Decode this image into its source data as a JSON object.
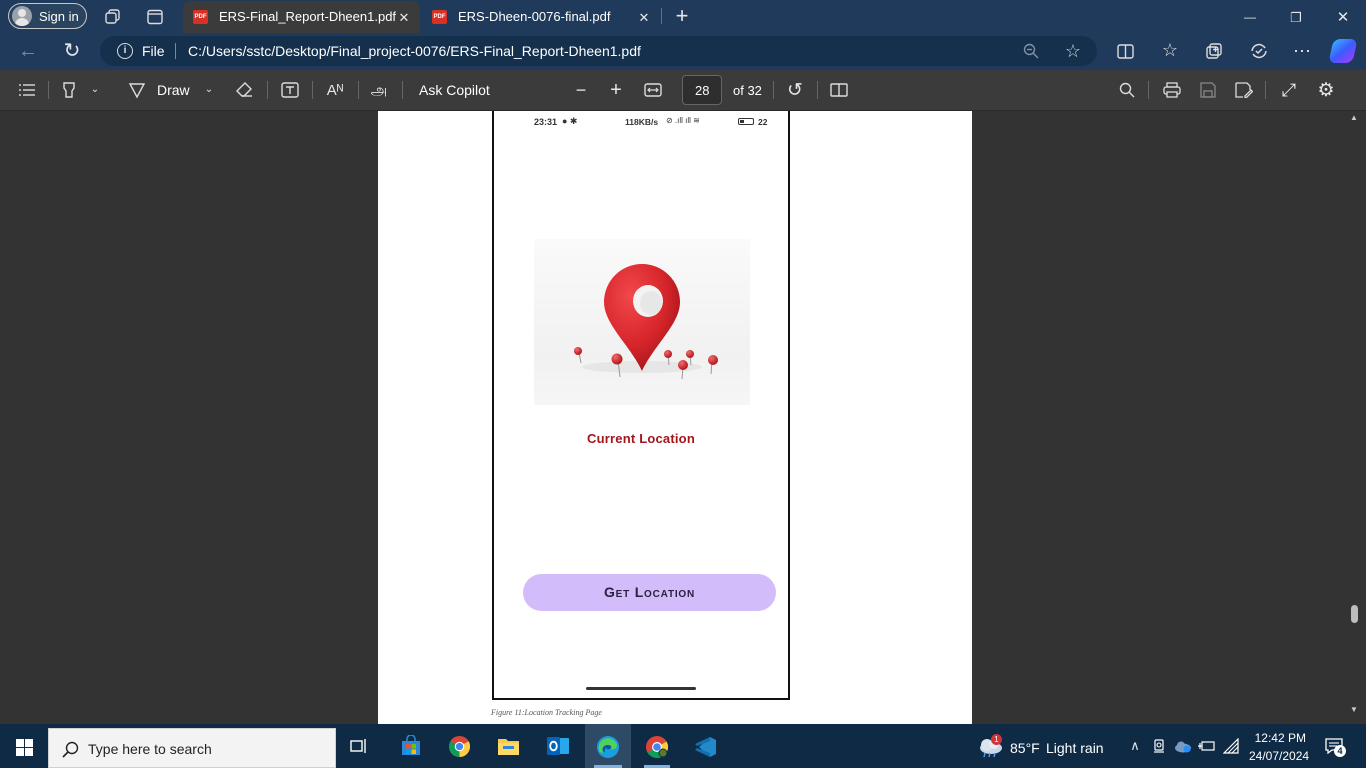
{
  "titlebar": {
    "sign_in": "Sign in",
    "tabs": [
      {
        "label": "ERS-Final_Report-Dheen1.pdf",
        "pdf_badge": "PDF"
      },
      {
        "label": "ERS-Dheen-0076-final.pdf",
        "pdf_badge": "PDF"
      }
    ],
    "new_tab": "+",
    "minimize": "—",
    "restore": "❐",
    "close": "✕"
  },
  "address": {
    "scheme": "File",
    "url": "C:/Users/sstc/Desktop/Final_project-0076/ERS-Final_Report-Dheen1.pdf"
  },
  "pdf_toolbar": {
    "draw": "Draw",
    "ask_copilot": "Ask Copilot",
    "current_page": "28",
    "total_pages": "of 32"
  },
  "phone": {
    "status_time": "23:31",
    "status_right": "118KB/s",
    "battery": "22",
    "heading": "Current Location",
    "button": "Get Location"
  },
  "figure_caption": "Figure 11:Location Tracking Page",
  "taskbar": {
    "search_placeholder": "Type here to search",
    "weather_temp": "85°F",
    "weather_desc": "Light rain",
    "weather_badge": "1",
    "time": "12:42 PM",
    "date": "24/07/2024",
    "notifications": "4"
  },
  "colors": {
    "accent": "#1f3a5a",
    "pin_red": "#d7262b",
    "heading_red": "#a3161c",
    "button_lilac": "#d2bdfa",
    "button_text": "#2a2140"
  }
}
